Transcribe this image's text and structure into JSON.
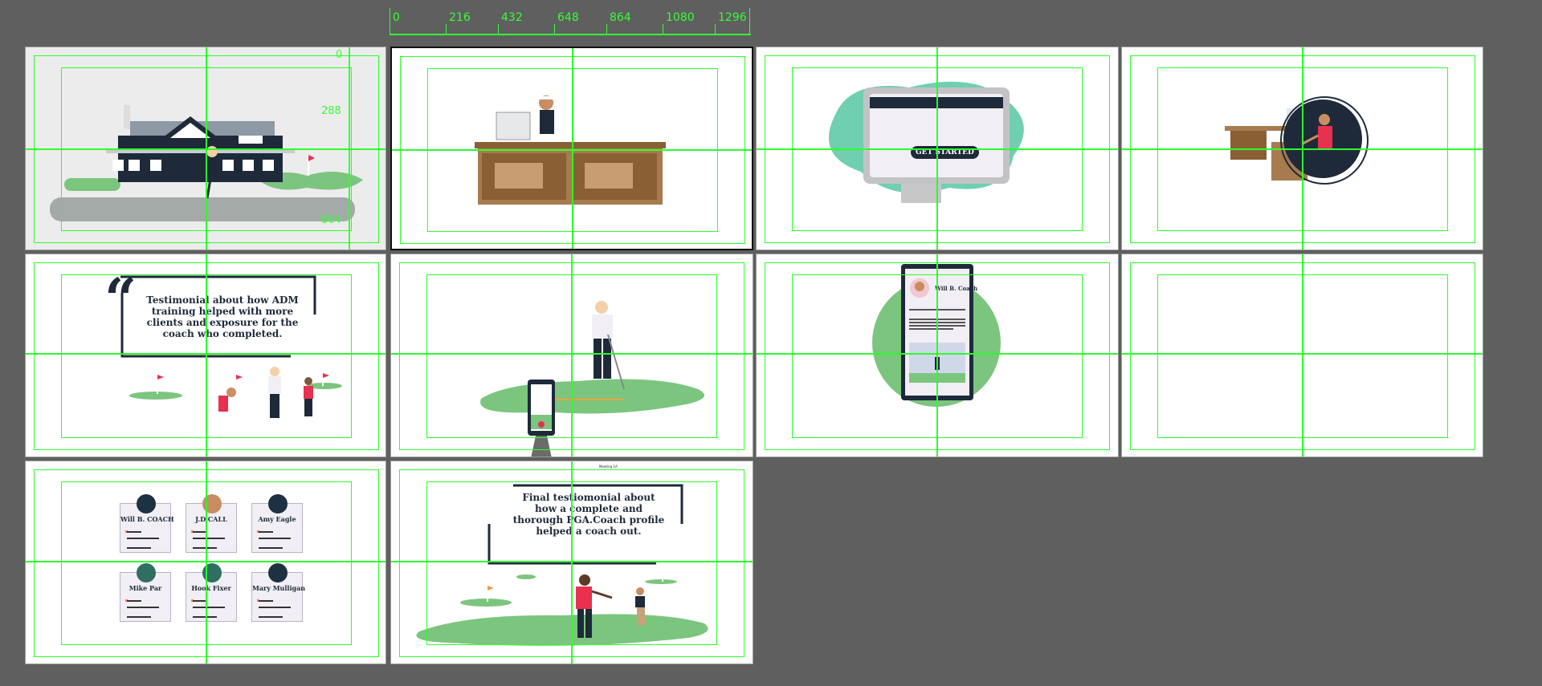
{
  "ruler": {
    "top_labels": [
      "0",
      "216",
      "432",
      "648",
      "864",
      "1080",
      "1296"
    ],
    "side_labels": [
      "0",
      "288",
      "864"
    ]
  },
  "artboards": [
    {
      "id": 1,
      "scene": "clubhouse"
    },
    {
      "id": 2,
      "scene": "reception-desk",
      "selected": true
    },
    {
      "id": 3,
      "scene": "monitor",
      "button_label": "GET STARTED"
    },
    {
      "id": 4,
      "scene": "desk-circle"
    },
    {
      "id": 5,
      "scene": "testimonial",
      "quote": "Testimonial about how ADM training helped with more clients and exposure for the coach who completed."
    },
    {
      "id": 6,
      "scene": "golfer-phone"
    },
    {
      "id": 7,
      "scene": "phone-profile",
      "profile_name": "Will B. Coach"
    },
    {
      "id": 8,
      "scene": "blank"
    },
    {
      "id": 9,
      "scene": "coach-cards"
    },
    {
      "id": 10,
      "scene": "final-testimonial",
      "quote": "Final testiomonial about how a complete and thorough PGA.Coach profile helped a coach out.",
      "caption": "Meeting 1A"
    }
  ],
  "coaches": [
    {
      "name": "Will B. COACH"
    },
    {
      "name": "J.D CALL"
    },
    {
      "name": "Amy Eagle"
    },
    {
      "name": "Mike Par"
    },
    {
      "name": "Hook Fixer"
    },
    {
      "name": "Mary Mulligan"
    }
  ],
  "colors": {
    "canvas": "#5f5f5f",
    "guide": "#2bff2b",
    "navy": "#1e2a3a",
    "grass": "#7cc57e",
    "wood": "#a87b4f",
    "teal": "#6fcfb0",
    "red": "#e8304f"
  }
}
